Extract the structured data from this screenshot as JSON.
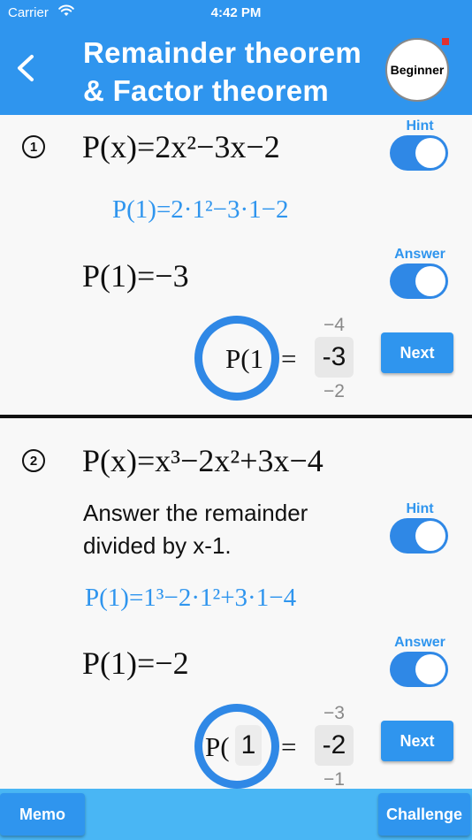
{
  "status": {
    "carrier": "Carrier",
    "time": "4:42 PM"
  },
  "header": {
    "title_line1": "Remainder theorem",
    "title_line2": "& Factor theorem",
    "level_badge": "Beginner",
    "colors": {
      "bar": "#2f95ee",
      "accent": "#2f88e6"
    }
  },
  "problems": [
    {
      "number": "1",
      "expression": "P(x)=2x²−3x−2",
      "hint_label": "Hint",
      "hint": "P(1)=2·1²−3·1−2",
      "answer_label": "Answer",
      "answer": "P(1)=−3",
      "picker": {
        "prefix": "P(1",
        "equals": "=",
        "above": "−4",
        "selected": "-3",
        "below": "−2"
      },
      "next_label": "Next"
    },
    {
      "number": "2",
      "expression": "P(x)=x³−2x²+3x−4",
      "question_line1": "Answer the remainder",
      "question_line2": "divided by x-1.",
      "hint_label": "Hint",
      "hint": "P(1)=1³−2·1²+3·1−4",
      "answer_label": "Answer",
      "answer": "P(1)=−2",
      "picker": {
        "prefix": "P(",
        "digit": "1",
        "equals": "=",
        "above": "−3",
        "selected": "-2",
        "below": "−1"
      },
      "next_label": "Next"
    }
  ],
  "footer": {
    "memo_label": "Memo",
    "challenge_label": "Challenge"
  }
}
